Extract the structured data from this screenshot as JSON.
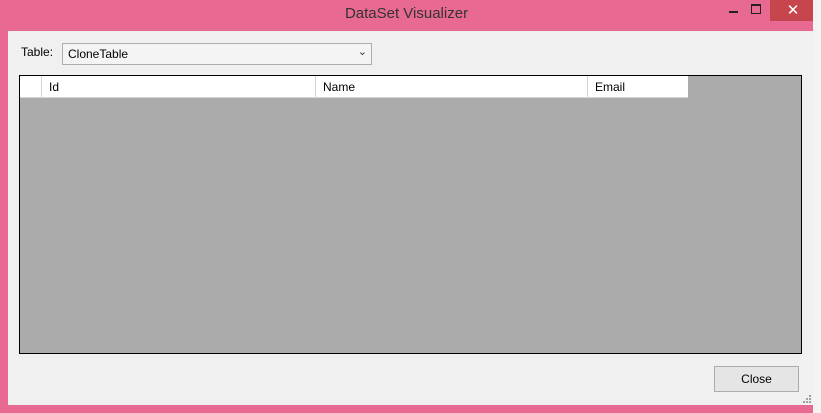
{
  "window": {
    "title": "DataSet Visualizer",
    "accent_color": "#e86a92",
    "close_color": "#c7464e",
    "icons": [
      "minimize-icon",
      "maximize-icon",
      "close-icon"
    ]
  },
  "table_picker": {
    "label": "Table:",
    "selected": "CloneTable"
  },
  "grid": {
    "columns": [
      "Id",
      "Name",
      "Email"
    ],
    "rows": [],
    "empty_area_color": "#ababab"
  },
  "footer": {
    "close_label": "Close"
  }
}
